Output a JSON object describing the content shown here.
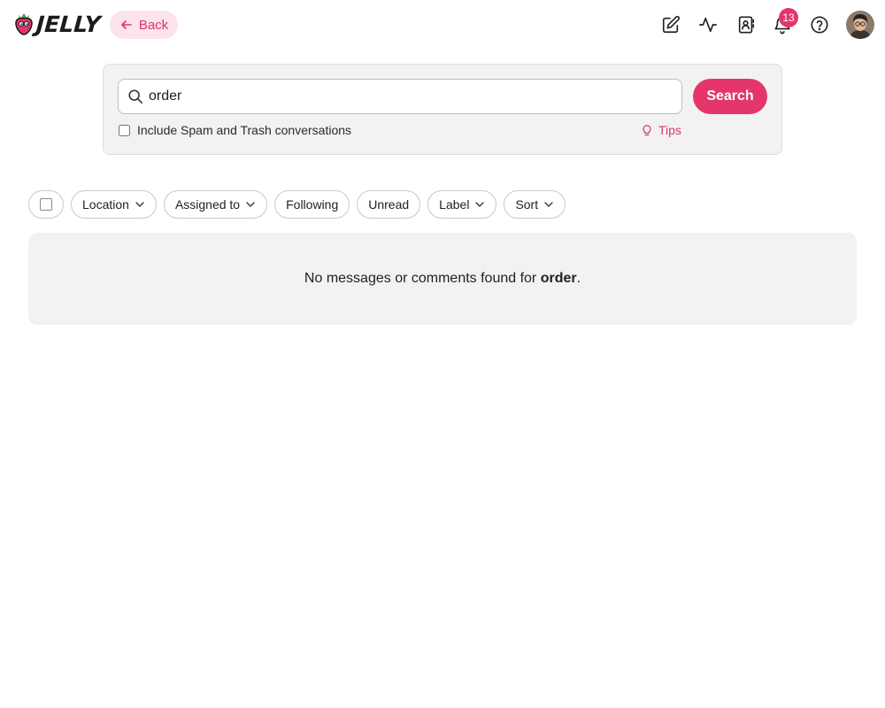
{
  "header": {
    "logo_text": "JELLY",
    "back_label": "Back",
    "notification_count": "13",
    "icons": [
      "compose-icon",
      "activity-icon",
      "contacts-icon",
      "bell-icon",
      "help-icon"
    ]
  },
  "search": {
    "query": "order",
    "button_label": "Search",
    "spam_label": "Include Spam and Trash conversations",
    "tips_label": "Tips"
  },
  "filters": {
    "location": "Location",
    "assigned_to": "Assigned to",
    "following": "Following",
    "unread": "Unread",
    "label": "Label",
    "sort": "Sort"
  },
  "results": {
    "empty_prefix": "No messages or comments found for ",
    "empty_term": "order",
    "empty_suffix": "."
  },
  "colors": {
    "accent": "#e4366b",
    "accent_soft": "#fde3ea",
    "panel": "#f2f2f2"
  }
}
